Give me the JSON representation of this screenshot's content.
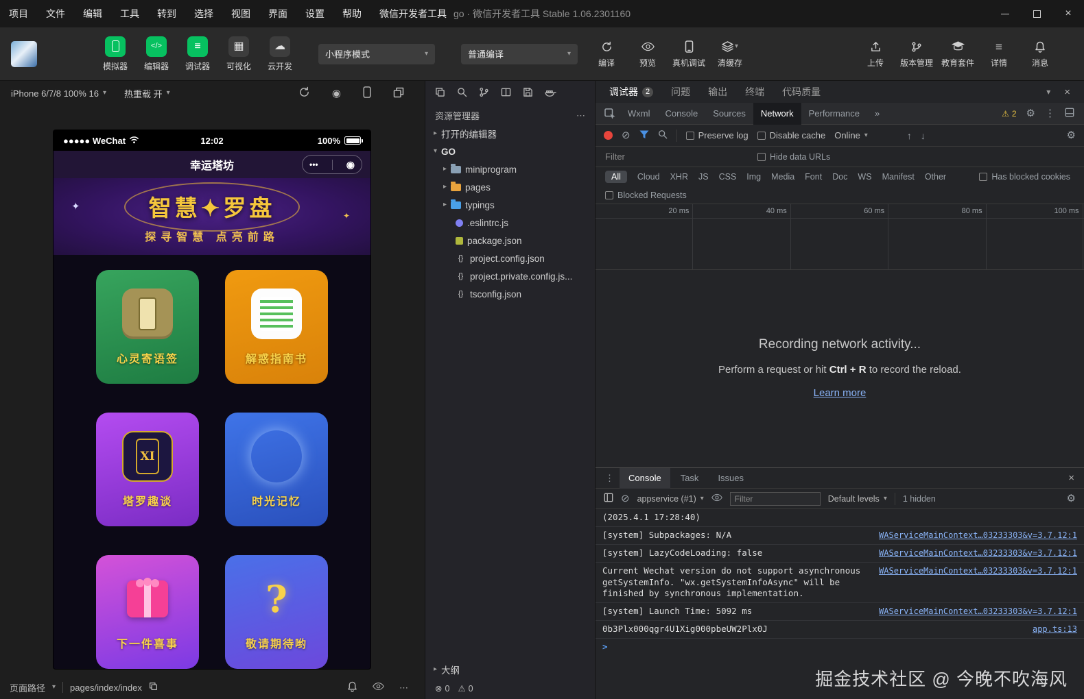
{
  "icons": {
    "chevron_down": "▾",
    "chevron_right": "▸",
    "more_h": "⋯",
    "more_v": "⋮",
    "close": "×",
    "record": "◉",
    "grid": "▦",
    "cloud": "☁",
    "menu": "≡",
    "sliders": "≡",
    "code": "</>",
    "warning": "⚠",
    "block": "⊘",
    "error": "⊗",
    "gear": "⚙",
    "more_tabs": "»",
    "braces": "{}",
    "arrow_up": "↑",
    "arrow_down": "↓",
    "prompt": ">",
    "capsule_more": "•••",
    "capsule_target": "◉",
    "star_left": "✦",
    "star_right": "✦"
  },
  "window": {
    "title": "go · 微信开发者工具 Stable 1.06.2301160"
  },
  "menubar": {
    "items": [
      "项目",
      "文件",
      "编辑",
      "工具",
      "转到",
      "选择",
      "视图",
      "界面",
      "设置",
      "帮助",
      "微信开发者工具"
    ]
  },
  "toolbar": {
    "buttons": [
      "模拟器",
      "编辑器",
      "调试器",
      "可视化",
      "云开发"
    ],
    "mode_select": "小程序模式",
    "compile_select": "普通编译",
    "actions": [
      "编译",
      "预览",
      "真机调试",
      "清缓存"
    ],
    "right_buttons": [
      "上传",
      "版本管理",
      "教育套件",
      "详情",
      "消息"
    ]
  },
  "simulator": {
    "device": "iPhone 6/7/8 100% 16",
    "hot_reload": "热重载 开",
    "footer_label": "页面路径",
    "footer_path": "pages/index/index"
  },
  "phone": {
    "carrier": "●●●●● WeChat",
    "time": "12:02",
    "battery": "100%",
    "nav_title": "幸运塔坊",
    "banner_title": "智慧✦罗盘",
    "banner_subtitle": "探寻智慧 点亮前路",
    "cards": [
      {
        "title": "心灵寄语签"
      },
      {
        "title": "解惑指南书"
      },
      {
        "title": "塔罗趣谈",
        "icon_text": "XI"
      },
      {
        "title": "时光记忆"
      },
      {
        "title": "下一件喜事"
      },
      {
        "title": "敬请期待哟",
        "icon_text": "?"
      }
    ]
  },
  "explorer": {
    "title": "资源管理器",
    "open_editors": "打开的编辑器",
    "root": "GO",
    "items": [
      {
        "name": "miniprogram"
      },
      {
        "name": "pages"
      },
      {
        "name": "typings"
      },
      {
        "name": ".eslintrc.js"
      },
      {
        "name": "package.json"
      },
      {
        "name": "project.config.json"
      },
      {
        "name": "project.private.config.js..."
      },
      {
        "name": "tsconfig.json"
      }
    ],
    "outline": "大纲",
    "errors": "0",
    "warnings": "0"
  },
  "devtools": {
    "panel_tabs": [
      "调试器",
      "问题",
      "输出",
      "终端",
      "代码质量"
    ],
    "panel_badge": "2",
    "tabs": [
      "Wxml",
      "Console",
      "Sources",
      "Network",
      "Performance"
    ],
    "warn_badge": "2",
    "network": {
      "preserve_log": "Preserve log",
      "disable_cache": "Disable cache",
      "throttling": "Online",
      "filter_placeholder": "Filter",
      "hide_data_urls": "Hide data URLs",
      "chips": [
        "All",
        "Cloud",
        "XHR",
        "JS",
        "CSS",
        "Img",
        "Media",
        "Font",
        "Doc",
        "WS",
        "Manifest",
        "Other"
      ],
      "has_blocked_cookies": "Has blocked cookies",
      "blocked_requests": "Blocked Requests",
      "ticks": [
        "20 ms",
        "40 ms",
        "60 ms",
        "80 ms",
        "100 ms"
      ],
      "empty_title": "Recording network activity...",
      "empty_pre": "Perform a request or hit ",
      "empty_key": "Ctrl + R",
      "empty_post": " to record the reload.",
      "learn_more": "Learn more"
    },
    "console": {
      "tabs": [
        "Console",
        "Task",
        "Issues"
      ],
      "context": "appservice (#1)",
      "filter_placeholder": "Filter",
      "levels": "Default levels",
      "hidden_count": "1 hidden",
      "logs": [
        {
          "text": "(2025.4.1 17:28:40)",
          "source": ""
        },
        {
          "text": "[system] Subpackages: N/A",
          "source": "WAServiceMainContext…03233303&v=3.7.12:1"
        },
        {
          "text": "[system] LazyCodeLoading: false",
          "source": "WAServiceMainContext…03233303&v=3.7.12:1"
        },
        {
          "text": "Current Wechat version do not support asynchronous getSystemInfo. \"wx.getSystemInfoAsync\" will be finished by synchronous implementation.",
          "source": "WAServiceMainContext…03233303&v=3.7.12:1"
        },
        {
          "text": "[system] Launch Time: 5092 ms",
          "source": "WAServiceMainContext…03233303&v=3.7.12:1"
        },
        {
          "text": "0b3Plx000qgr4U1Xig000pbeUW2Plx0J",
          "source": "app.ts:13"
        }
      ]
    }
  },
  "watermark": "掘金技术社区 @ 今晚不吹海风"
}
